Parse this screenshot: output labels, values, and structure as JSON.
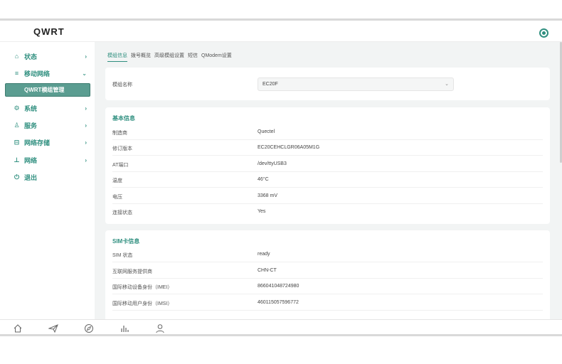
{
  "app": {
    "title": "QWRT"
  },
  "sidebar": {
    "items": [
      {
        "label": "状态",
        "icon": "home-icon",
        "glyph": "⌂",
        "arrow": "›"
      },
      {
        "label": "移动网络",
        "icon": "database-icon",
        "glyph": "≡",
        "arrow": "⌄"
      },
      {
        "label": "系统",
        "icon": "cog-icon",
        "glyph": "⚙",
        "arrow": "›"
      },
      {
        "label": "服务",
        "icon": "user-icon",
        "glyph": "♙",
        "arrow": "›"
      },
      {
        "label": "网络存储",
        "icon": "storage-icon",
        "glyph": "⊟",
        "arrow": "›"
      },
      {
        "label": "网络",
        "icon": "network-icon",
        "glyph": "⊥",
        "arrow": "›"
      },
      {
        "label": "退出",
        "icon": "power-icon",
        "glyph": "⏻",
        "arrow": ""
      }
    ],
    "active_sub": "QWRT模组管理"
  },
  "tabs": [
    "模组信息",
    "拨号概览",
    "高级模组设置",
    "短信",
    "QModem设置"
  ],
  "module": {
    "label": "模组名称",
    "value": "EC20F",
    "chevron": "⌄"
  },
  "basic": {
    "title": "基本信息",
    "rows": [
      {
        "k": "制造商",
        "v": "Quectel"
      },
      {
        "k": "修订版本",
        "v": "EC20CEHCLGR06A05M1G"
      },
      {
        "k": "AT端口",
        "v": "/dev/ttyUSB3"
      },
      {
        "k": "温度",
        "v": "46°C"
      },
      {
        "k": "电压",
        "v": "3368 mV"
      },
      {
        "k": "连接状态",
        "v": "Yes"
      }
    ]
  },
  "sim": {
    "title": "SIM卡信息",
    "rows": [
      {
        "k": "SIM 状态",
        "v": "ready"
      },
      {
        "k": "互联网服务提供商",
        "v": "CHN-CT"
      },
      {
        "k": "国际移动设备身份（IMEI）",
        "v": "866041048724980"
      },
      {
        "k": "国际移动用户身份（IMSI）",
        "v": "460115057596772"
      }
    ]
  },
  "bottom_icons": [
    "home-icon",
    "send-icon",
    "compass-icon",
    "bar-chart-icon",
    "user-icon"
  ],
  "colors": {
    "accent": "#2f8f7f",
    "active_bg": "#5b9d91",
    "main_bg": "#f2f4f4"
  }
}
